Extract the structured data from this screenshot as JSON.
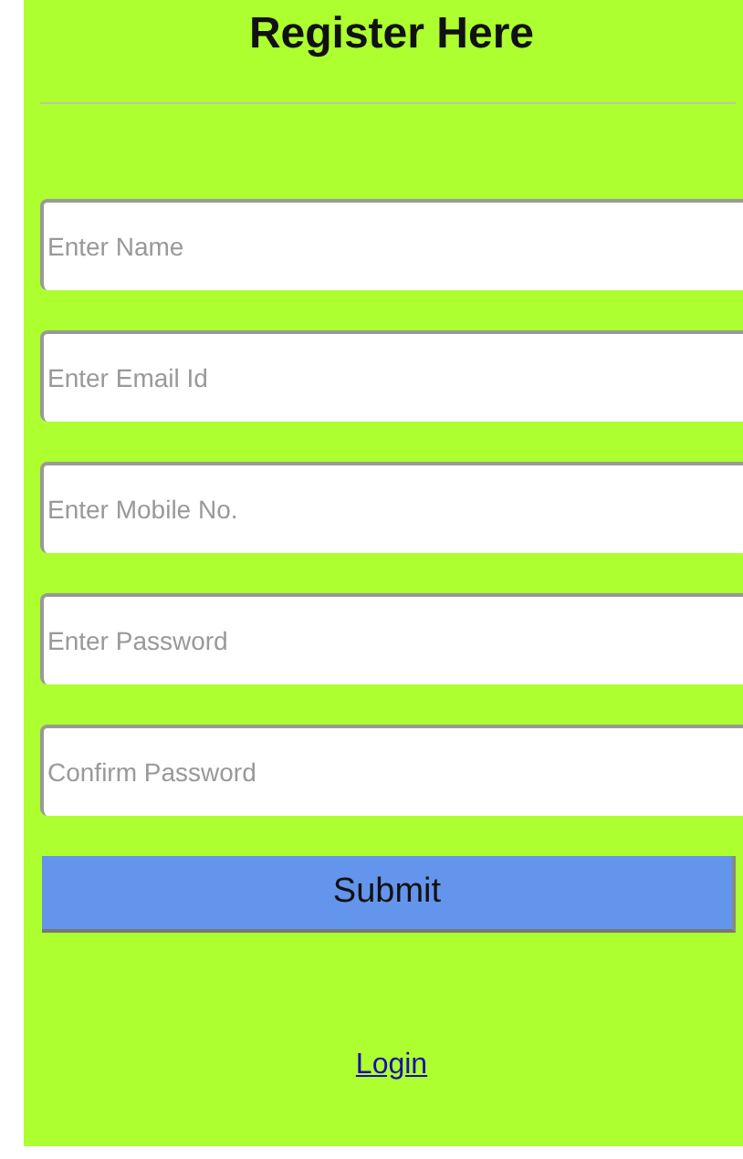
{
  "title": "Register Here",
  "fields": [
    {
      "placeholder": "Enter Name"
    },
    {
      "placeholder": "Enter Email Id"
    },
    {
      "placeholder": "Enter Mobile No."
    },
    {
      "placeholder": "Enter Password"
    },
    {
      "placeholder": "Confirm Password"
    }
  ],
  "submit_button": "Submit",
  "login_link": "Login"
}
